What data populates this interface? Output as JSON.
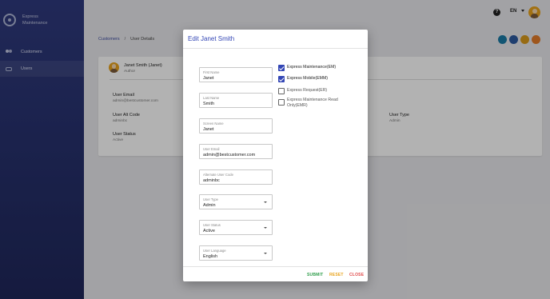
{
  "brand": {
    "name_line1": "Express",
    "name_line2": "Maintenance"
  },
  "sidebar": {
    "items": [
      {
        "label": "Customers",
        "icon": "people-icon"
      },
      {
        "label": "Users",
        "icon": "users-icon"
      }
    ]
  },
  "topbar": {
    "help_icon": "?",
    "language": "EN"
  },
  "breadcrumb": {
    "parent": "Customers",
    "separator": "/",
    "current": "User Details"
  },
  "user_card": {
    "name": "Janet Smith (Janet)",
    "role": "Author",
    "fields": [
      {
        "label": "User Email",
        "value": "admin@bestcustomer.com"
      },
      {
        "label": "User Alt Code",
        "value": "adminbc"
      },
      {
        "label": "User Status",
        "value": "Active"
      },
      {
        "label": "User Type",
        "value": "Admin"
      }
    ]
  },
  "action_buttons": [
    {
      "name": "view-action",
      "color": "#1b7aa5"
    },
    {
      "name": "users-action",
      "color": "#2c5aa0"
    },
    {
      "name": "edit-action",
      "color": "#d99a1c"
    },
    {
      "name": "settings-action",
      "color": "#e27b2a"
    }
  ],
  "modal": {
    "title": "Edit Janet Smith",
    "fields": [
      {
        "label": "First Name",
        "value": "Janet"
      },
      {
        "label": "Last Name",
        "value": "Smith"
      },
      {
        "label": "Screen Name",
        "value": "Janet"
      },
      {
        "label": "User Email",
        "value": "admin@bestcustomer.com"
      },
      {
        "label": "Alternate User Code",
        "value": "adminbc"
      },
      {
        "label": "User Type",
        "value": "Admin"
      },
      {
        "label": "User Status",
        "value": "Active"
      },
      {
        "label": "User Language",
        "value": "English"
      }
    ],
    "checkboxes": [
      {
        "label": "Express Maintenance(EM)",
        "checked": true
      },
      {
        "label": "Express Mobile(EMM)",
        "checked": true
      },
      {
        "label": "Express Request(ER)",
        "checked": false
      },
      {
        "label": "Express Maintenance Read Only(EMR)",
        "checked": false
      }
    ],
    "buttons": {
      "submit": "SUBMIT",
      "reset": "RESET",
      "close": "CLOSE"
    }
  },
  "colors": {
    "accent": "#3346b5",
    "submit": "#2e9d4a",
    "reset": "#e8a31c",
    "close": "#e04a4a"
  }
}
